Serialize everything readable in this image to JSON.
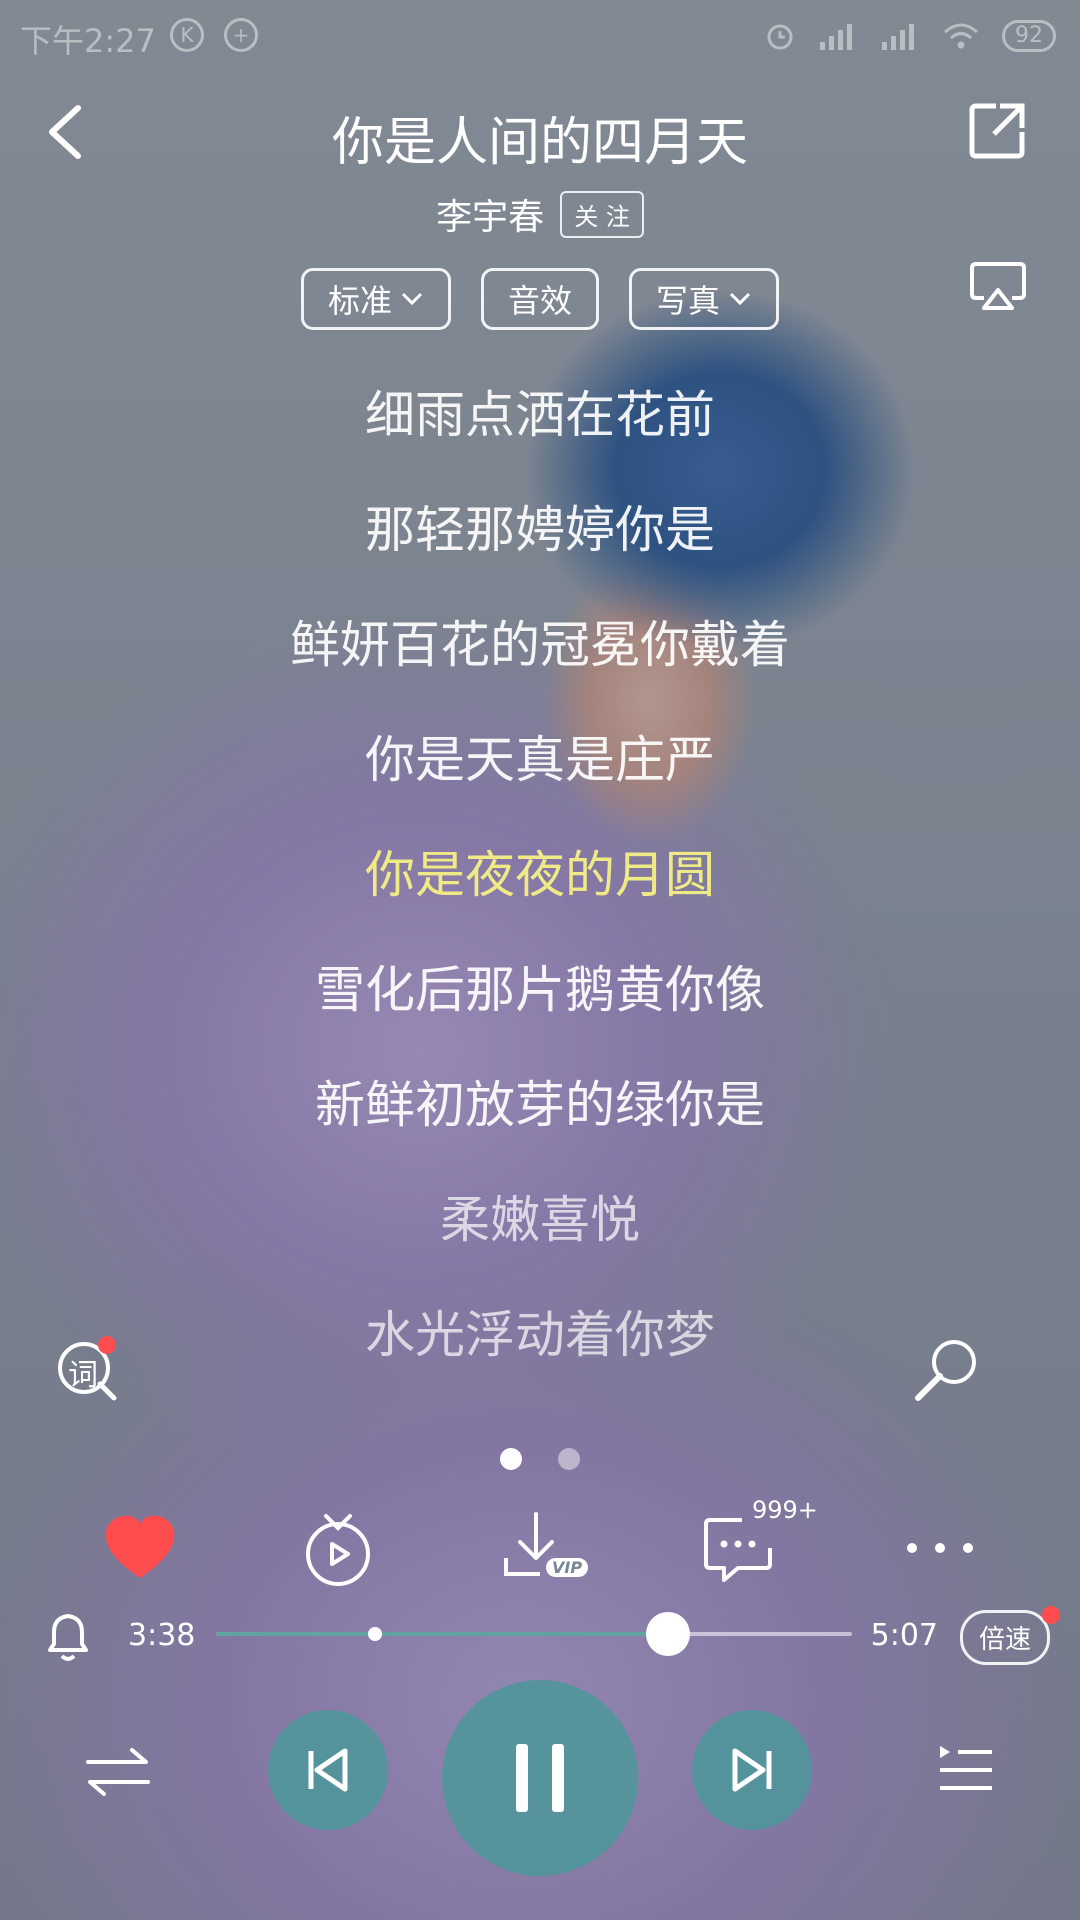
{
  "status_bar": {
    "time": "下午2:27",
    "battery": "92"
  },
  "header": {
    "title": "你是人间的四月天",
    "artist": "李宇春",
    "follow_label": "关 注"
  },
  "options": {
    "quality": "标准",
    "effects": "音效",
    "photo": "写真"
  },
  "lyrics": [
    "细雨点洒在花前",
    "那轻那娉婷你是",
    "鲜妍百花的冠冕你戴着",
    "你是天真是庄严",
    "你是夜夜的月圆",
    "雪化后那片鹅黄你像",
    "新鲜初放芽的绿你是",
    "柔嫩喜悦",
    "水光浮动着你梦"
  ],
  "current_lyric_index": 4,
  "word_icon_label": "词",
  "comments_count": "999+",
  "download_badge": "VIP",
  "progress": {
    "current": "3:38",
    "total": "5:07",
    "fraction": 0.71,
    "buffered_fraction": 0.25
  },
  "speed_label": "倍速",
  "page_indicator": {
    "count": 2,
    "active": 0
  },
  "colors": {
    "accent": "#5fa3a3",
    "current_lyric": "#f0ea86",
    "like": "#ff4d4f"
  }
}
